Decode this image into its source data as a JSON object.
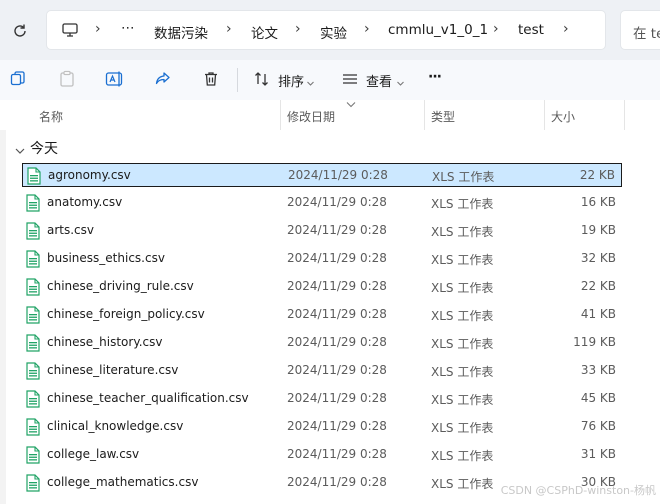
{
  "breadcrumb": {
    "overflow": "⋯",
    "items": [
      "数据污染",
      "论文",
      "实验",
      "cmmlu_v1_0_1",
      "test"
    ],
    "separator": "›"
  },
  "search": {
    "placeholder": "在 te"
  },
  "toolbar": {
    "sort_label": "排序",
    "view_label": "查看",
    "more_label": "···"
  },
  "columns": {
    "name": "名称",
    "date": "修改日期",
    "type": "类型",
    "size": "大小"
  },
  "group": {
    "label": "今天"
  },
  "files": [
    {
      "name": "agronomy.csv",
      "date": "2024/11/29 0:28",
      "type": "XLS 工作表",
      "size": "22 KB"
    },
    {
      "name": "anatomy.csv",
      "date": "2024/11/29 0:28",
      "type": "XLS 工作表",
      "size": "16 KB"
    },
    {
      "name": "arts.csv",
      "date": "2024/11/29 0:28",
      "type": "XLS 工作表",
      "size": "19 KB"
    },
    {
      "name": "business_ethics.csv",
      "date": "2024/11/29 0:28",
      "type": "XLS 工作表",
      "size": "32 KB"
    },
    {
      "name": "chinese_driving_rule.csv",
      "date": "2024/11/29 0:28",
      "type": "XLS 工作表",
      "size": "22 KB"
    },
    {
      "name": "chinese_foreign_policy.csv",
      "date": "2024/11/29 0:28",
      "type": "XLS 工作表",
      "size": "41 KB"
    },
    {
      "name": "chinese_history.csv",
      "date": "2024/11/29 0:28",
      "type": "XLS 工作表",
      "size": "119 KB"
    },
    {
      "name": "chinese_literature.csv",
      "date": "2024/11/29 0:28",
      "type": "XLS 工作表",
      "size": "33 KB"
    },
    {
      "name": "chinese_teacher_qualification.csv",
      "date": "2024/11/29 0:28",
      "type": "XLS 工作表",
      "size": "45 KB"
    },
    {
      "name": "clinical_knowledge.csv",
      "date": "2024/11/29 0:28",
      "type": "XLS 工作表",
      "size": "76 KB"
    },
    {
      "name": "college_law.csv",
      "date": "2024/11/29 0:28",
      "type": "XLS 工作表",
      "size": "31 KB"
    },
    {
      "name": "college_mathematics.csv",
      "date": "2024/11/29 0:28",
      "type": "XLS 工作表",
      "size": "30 KB"
    }
  ],
  "selected_index": 0,
  "watermark": "CSDN @CSPhD-winston-杨帆",
  "colors": {
    "selection_bg": "#cce8ff",
    "excel_green": "#21a366",
    "accent_blue": "#1a6fd1"
  },
  "icons": {
    "refresh": "refresh-icon",
    "computer": "computer-icon",
    "new": "new-item-icon",
    "copy": "copy-icon",
    "paste": "paste-icon",
    "rename": "rename-icon",
    "share": "share-icon",
    "delete": "delete-icon",
    "sort": "sort-icon",
    "view": "view-icon",
    "file": "csv-file-icon"
  }
}
